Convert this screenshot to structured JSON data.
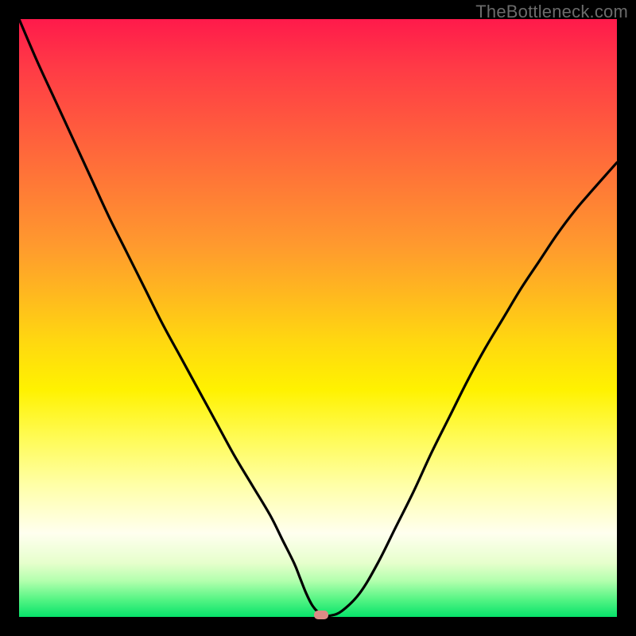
{
  "watermark": "TheBottleneck.com",
  "colors": {
    "frame": "#000000",
    "gradient_top": "#ff1a4b",
    "gradient_bottom": "#07e26a",
    "curve": "#000000",
    "marker": "#db8b86",
    "watermark_text": "#6b6b6b"
  },
  "chart_data": {
    "type": "line",
    "title": "",
    "xlabel": "",
    "ylabel": "",
    "xlim": [
      0,
      100
    ],
    "ylim": [
      0,
      100
    ],
    "grid": false,
    "series": [
      {
        "name": "bottleneck-curve",
        "x": [
          0,
          3,
          6,
          9,
          12,
          15,
          18,
          21,
          24,
          27,
          30,
          33,
          36,
          39,
          42,
          44,
          46,
          47,
          48,
          49,
          50,
          51,
          52,
          54,
          57,
          60,
          63,
          66,
          69,
          72,
          75,
          78,
          81,
          84,
          87,
          90,
          93,
          96,
          100
        ],
        "y": [
          100,
          93,
          86.5,
          80,
          73.5,
          67,
          61,
          55,
          49,
          43.5,
          38,
          32.5,
          27,
          22,
          17,
          13,
          9,
          6.5,
          4,
          2,
          0.8,
          0.2,
          0.2,
          1,
          4,
          9,
          15,
          21,
          27.5,
          33.5,
          39.5,
          45,
          50,
          55,
          59.5,
          64,
          68,
          71.5,
          76
        ]
      }
    ],
    "annotations": [
      {
        "name": "optimum-marker",
        "x": 50.5,
        "y": 0.3
      }
    ]
  }
}
